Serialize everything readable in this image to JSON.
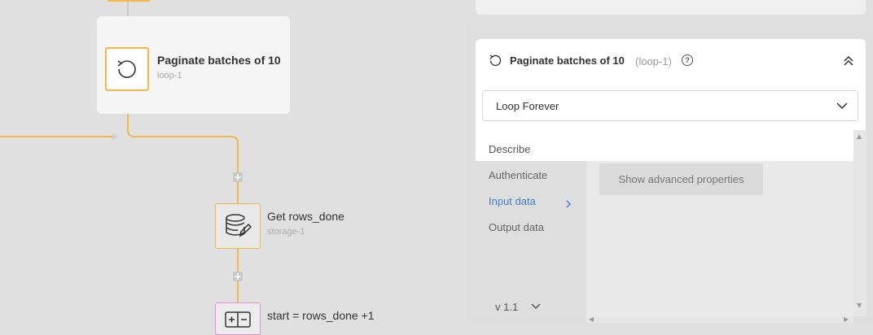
{
  "canvas": {
    "loop_node": {
      "title": "Paginate batches of 10",
      "id": "loop-1"
    },
    "storage_node": {
      "title": "Get rows_done",
      "id": "storage-1"
    },
    "script_node": {
      "title": "start = rows_done +1"
    },
    "add_step_symbol": "+"
  },
  "panel": {
    "title": "Paginate batches of 10",
    "id_label": "(loop-1)",
    "help_symbol": "?",
    "loop_mode": "Loop Forever",
    "nav": [
      "Describe",
      "Authenticate",
      "Input data",
      "Output data"
    ],
    "active_nav": "Input data",
    "advanced_button": "Show advanced properties",
    "version": "v 1.1"
  },
  "colors": {
    "connector": "#f4b74a",
    "active": "#4a7cc9",
    "script_border": "#e48fd3"
  }
}
